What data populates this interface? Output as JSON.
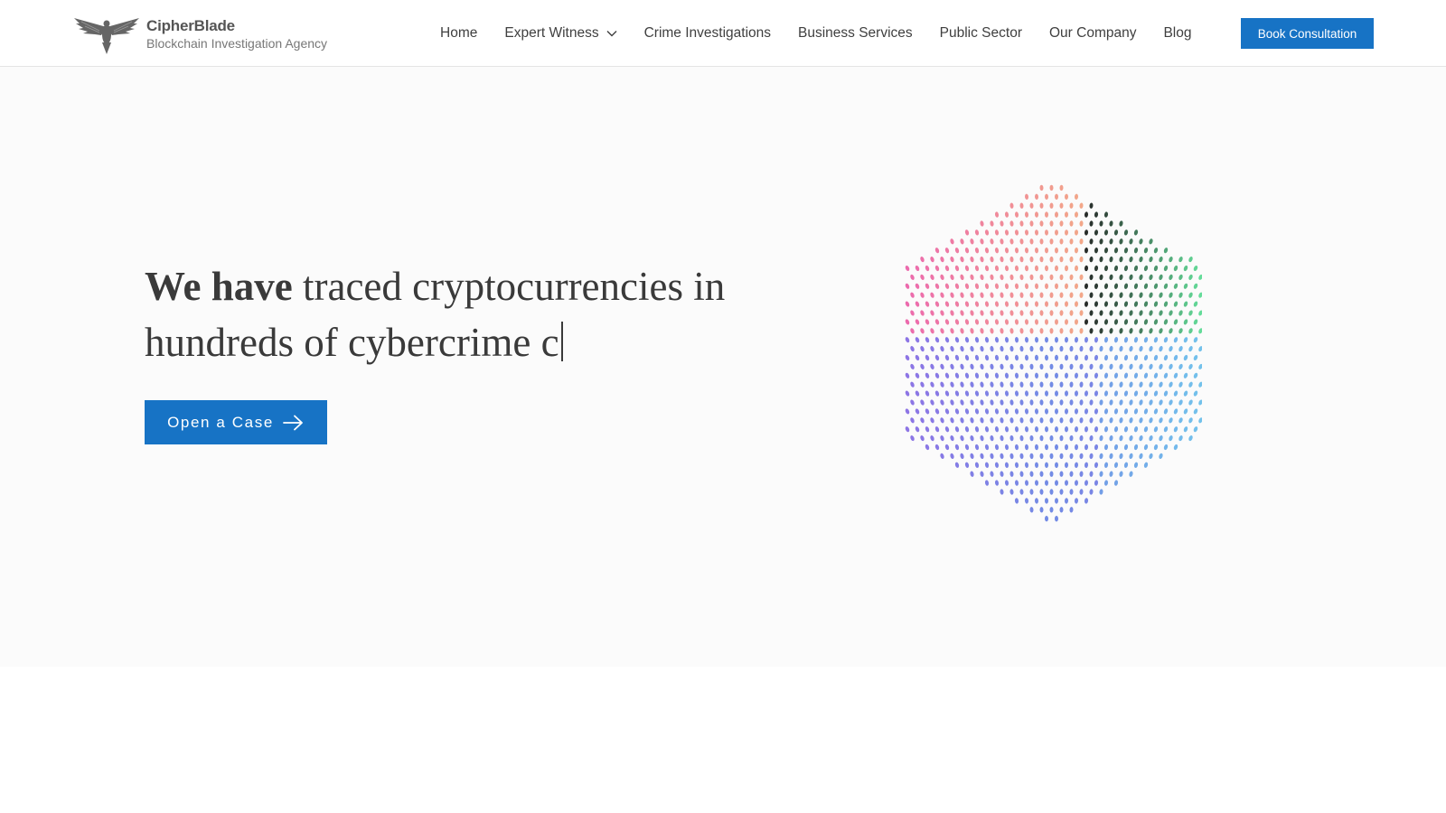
{
  "colors": {
    "accent": "#1773c5",
    "hero_background": "#fbfbfb",
    "heading_text": "#3a3a3a",
    "cube_palette": [
      "#e94fa0",
      "#f2a66b",
      "#4bd88a",
      "#5a78e0",
      "#7a5ce0",
      "#5ab8e8"
    ]
  },
  "brand": {
    "name": "CipherBlade",
    "tagline": "Blockchain Investigation Agency",
    "logo_icon": "eagle-logo-icon"
  },
  "nav": {
    "items": [
      {
        "label": "Home"
      },
      {
        "label": "Expert Witness",
        "icon": "chevron-down-icon"
      },
      {
        "label": "Crime Investigations"
      },
      {
        "label": "Business Services"
      },
      {
        "label": "Public Sector"
      },
      {
        "label": "Our Company"
      },
      {
        "label": "Blog"
      }
    ],
    "cta_label": "Book Consultation"
  },
  "hero": {
    "heading_bold": "We have",
    "heading_rest": " traced cryptocurrencies in hundreds of cybercrime c",
    "button_label": "Open a Case",
    "button_icon": "arrow-right-icon",
    "graphic": "dotted-cube-graphic"
  }
}
